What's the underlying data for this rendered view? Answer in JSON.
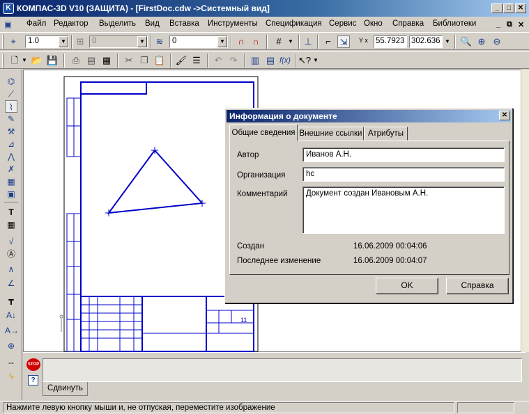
{
  "app": {
    "title": "КОМПАС-3D V10 (ЗАЩИТА) - [FirstDoc.cdw ->Системный вид]",
    "icon_label": "K"
  },
  "menu": [
    "Файл",
    "Редактор",
    "Выделить",
    "Вид",
    "Вставка",
    "Инструменты",
    "Спецификация",
    "Сервис",
    "Окно",
    "Справка",
    "Библиотеки"
  ],
  "toolbar": {
    "scale_value": "1.0",
    "layer_value": "0",
    "style_value": "0",
    "coord_label": "Y x",
    "coord_x": "55.7923",
    "coord_y": "302.636"
  },
  "drawing": {
    "sheet_number": "11"
  },
  "dialog": {
    "title": "Информация о документе",
    "tabs": [
      "Общие сведения",
      "Внешние ссылки",
      "Атрибуты"
    ],
    "author_label": "Автор",
    "author_value": "Иванов А.Н.",
    "org_label": "Организация",
    "org_value": "hc",
    "comment_label": "Комментарий",
    "comment_value": "Документ создан Ивановым А.Н.",
    "created_label": "Создан",
    "created_value": "16.06.2009  00:04:06",
    "modified_label": "Последнее изменение",
    "modified_value": "16.06.2009  00:04:07",
    "ok_label": "OK",
    "help_label": "Справка"
  },
  "property_panel": {
    "tab_label": "Сдвинуть",
    "stop_label": "STOP",
    "help_icon": "?"
  },
  "status": {
    "message": "Нажмите левую кнопку мыши и, не отпуская, переместите изображение"
  },
  "colors": {
    "drawing_blue": "#0000c8",
    "title_bar": "#0a246a"
  }
}
